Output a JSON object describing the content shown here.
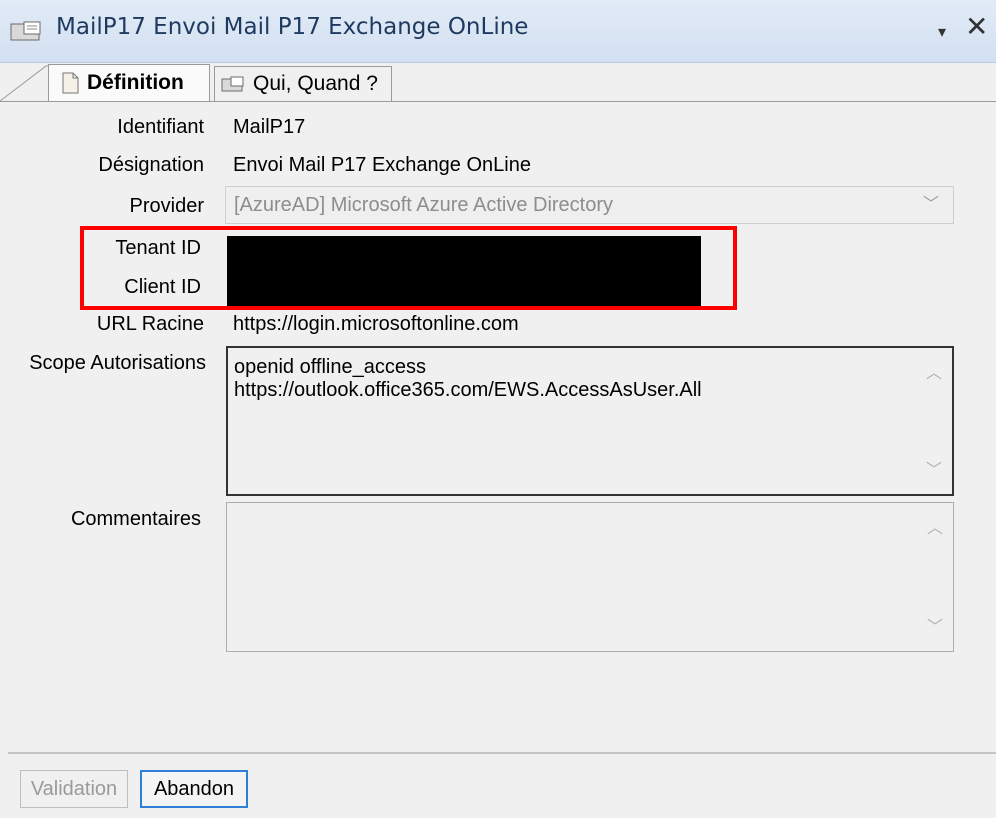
{
  "window": {
    "title": "MailP17 Envoi Mail P17 Exchange OnLine",
    "title_icon": "folder-sheet-icon",
    "dropdown_icon": "▾",
    "close_icon": "✕"
  },
  "tabs": [
    {
      "label": "Définition",
      "icon": "document-icon",
      "active": true
    },
    {
      "label": "Qui, Quand ?",
      "icon": "folder-sheet-icon",
      "active": false
    }
  ],
  "form": {
    "identifiant": {
      "label": "Identifiant",
      "value": "MailP17"
    },
    "designation": {
      "label": "Désignation",
      "value": "Envoi Mail P17 Exchange OnLine"
    },
    "provider": {
      "label": "Provider",
      "value": "[AzureAD] Microsoft Azure Active Directory",
      "disabled": true
    },
    "tenant_id": {
      "label": "Tenant ID"
    },
    "client_id": {
      "label": "Client ID"
    },
    "url_racine": {
      "label": "URL Racine",
      "value": "https://login.microsoftonline.com"
    },
    "scope": {
      "label": "Scope Autorisations",
      "line1": "openid offline_access",
      "line2": "https://outlook.office365.com/EWS.AccessAsUser.All"
    },
    "commentaires": {
      "label": "Commentaires",
      "value": ""
    }
  },
  "buttons": {
    "validation": "Validation",
    "abandon": "Abandon"
  },
  "colors": {
    "highlight": "#ff0000",
    "focus_border": "#2f7fd6",
    "title_text": "#1e3a5f"
  }
}
